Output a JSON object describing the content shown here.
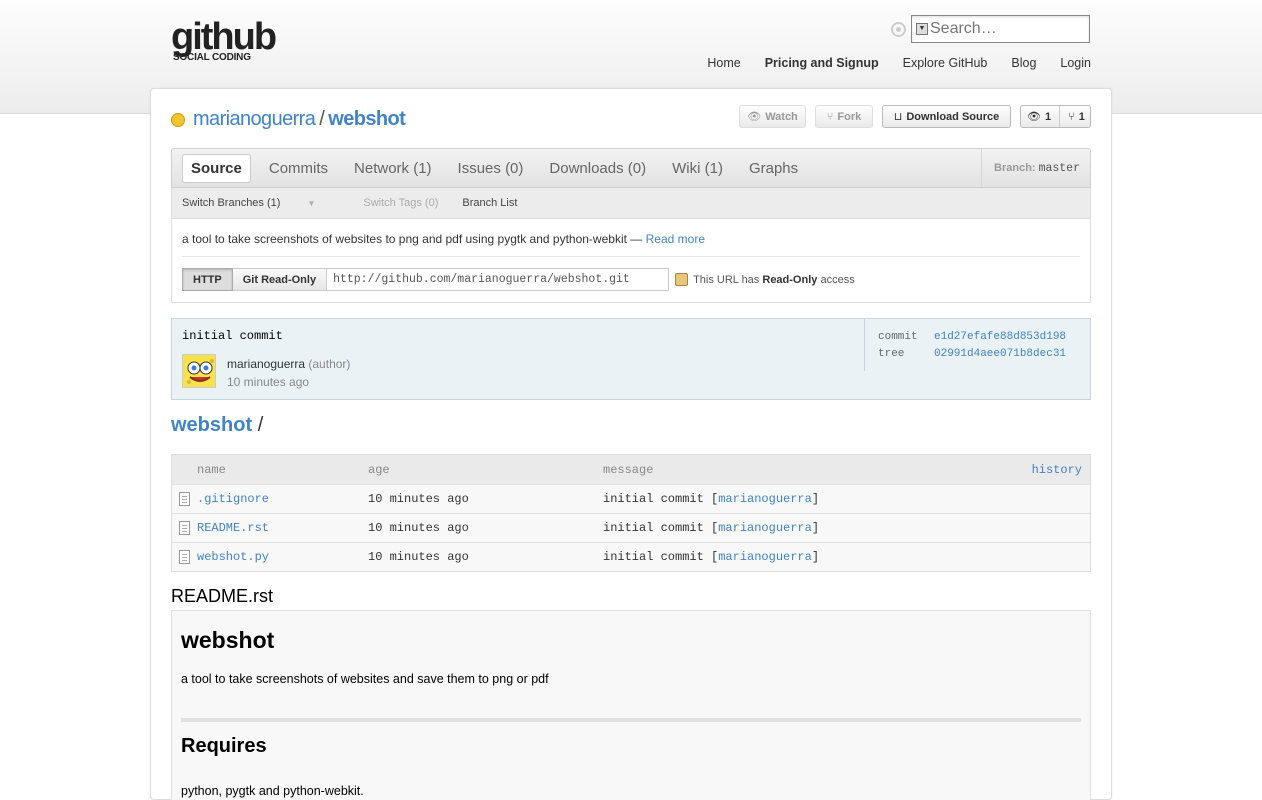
{
  "header": {
    "logo_main": "github",
    "logo_sub": "SOCIAL CODING",
    "search_placeholder": "Search…",
    "nav": [
      "Home",
      "Pricing and Signup",
      "Explore GitHub",
      "Blog",
      "Login"
    ]
  },
  "repo": {
    "owner": "marianoguerra",
    "separator": "/",
    "name": "webshot",
    "buttons": {
      "watch": "Watch",
      "fork": "Fork",
      "download": "Download Source",
      "watchers": "1",
      "forks": "1"
    }
  },
  "tabs": [
    "Source",
    "Commits",
    "Network (1)",
    "Issues (0)",
    "Downloads (0)",
    "Wiki (1)",
    "Graphs"
  ],
  "branch": {
    "label": "Branch:",
    "value": "master"
  },
  "subtabs": {
    "switch_branches": "Switch Branches (1)",
    "switch_tags": "Switch Tags (0)",
    "branch_list": "Branch List"
  },
  "description": {
    "text": "a tool to take screenshots of websites to png and pdf using pygtk and python-webkit —",
    "read_more": "Read more"
  },
  "clone": {
    "http": "HTTP",
    "git_readonly": "Git Read-Only",
    "url": "http://github.com/marianoguerra/webshot.git",
    "access_prefix": "This URL has",
    "access_level": "Read-Only",
    "access_suffix": "access"
  },
  "commit": {
    "message": "initial commit",
    "author": "marianoguerra",
    "role": "(author)",
    "time": "10 minutes ago",
    "commit_label": "commit",
    "commit_sha": "e1d27efafe88d853d198",
    "tree_label": "tree",
    "tree_sha": "02991d4aee071b8dec31"
  },
  "path": {
    "dir": "webshot",
    "sep": "/"
  },
  "files": {
    "columns": [
      "name",
      "age",
      "message",
      "history"
    ],
    "rows": [
      {
        "name": ".gitignore",
        "age": "10 minutes ago",
        "message": "initial commit [",
        "author": "marianoguerra",
        "close": "]"
      },
      {
        "name": "README.rst",
        "age": "10 minutes ago",
        "message": "initial commit [",
        "author": "marianoguerra",
        "close": "]"
      },
      {
        "name": "webshot.py",
        "age": "10 minutes ago",
        "message": "initial commit [",
        "author": "marianoguerra",
        "close": "]"
      }
    ]
  },
  "readme": {
    "filename": "README.rst",
    "h1": "webshot",
    "p1": "a tool to take screenshots of websites and save them to png or pdf",
    "h2": "Requires",
    "p2": "python, pygtk and python-webkit."
  },
  "colors": {
    "link": "#4183c4",
    "commit_bg": "#eaf2f5"
  }
}
